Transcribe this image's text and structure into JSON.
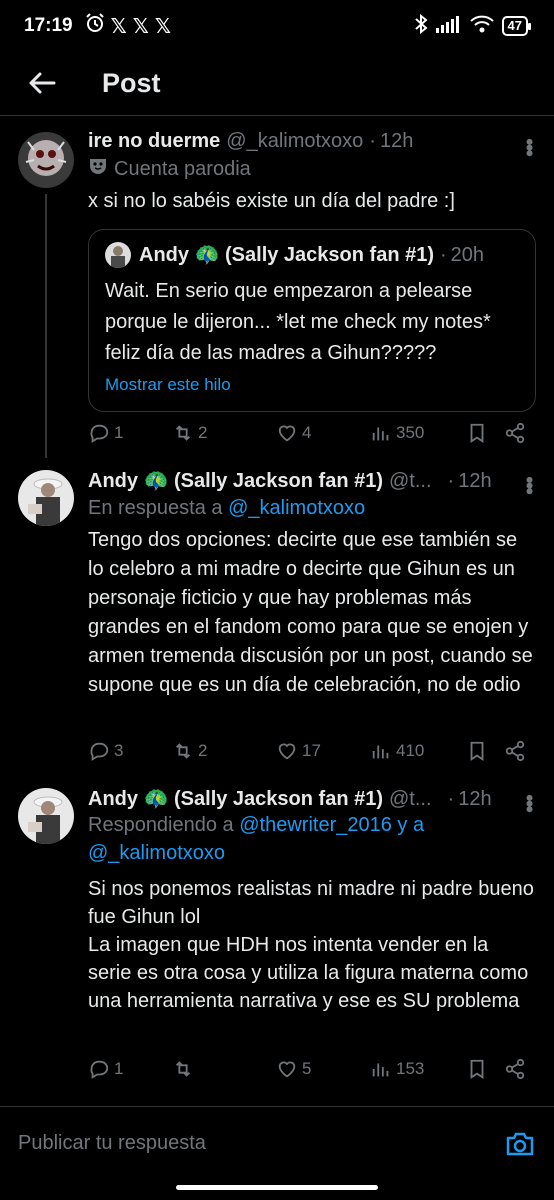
{
  "status_bar": {
    "time": "17:19",
    "battery": "47"
  },
  "header": {
    "title": "Post"
  },
  "posts": [
    {
      "display_name": "ire no duerme",
      "handle": "@_kalimotxoxo",
      "time": "12h",
      "label": "Cuenta parodia",
      "text": "x si no lo sabéis existe un día del padre :]",
      "quote": {
        "display_name": "Andy 🦚 (Sally Jackson fan #1)",
        "time": "20h",
        "text": "Wait. En serio que empezaron a pelearse porque le dijeron... *let me check my notes* feliz día de las madres a Gihun?????",
        "show_thread": "Mostrar este hilo"
      },
      "replies": "1",
      "retweets": "2",
      "likes": "4",
      "views": "350"
    },
    {
      "display_name": "Andy 🦚 (Sally Jackson fan #1)",
      "handle": "@t...",
      "time": "12h",
      "reply_prefix": "En respuesta a ",
      "reply_to": "@_kalimotxoxo",
      "text": "Tengo dos opciones: decirte que ese también se lo celebro a mi madre o decirte que Gihun es un personaje ficticio y que hay problemas más grandes en el fandom como para que se enojen y armen tremenda discusión por un post, cuando se supone que es un día de celebración, no de odio",
      "replies": "3",
      "retweets": "2",
      "likes": "17",
      "views": "410"
    },
    {
      "display_name": "Andy 🦚 (Sally Jackson fan #1)",
      "handle": "@t...",
      "time": "12h",
      "reply_prefix": "Respondiendo a ",
      "reply_to": "@thewriter_2016 y a @_kalimotxoxo",
      "text": "Si nos ponemos realistas ni madre ni padre bueno fue Gihun lol\nLa imagen que HDH nos intenta vender en la serie es otra cosa y utiliza la figura materna como una herramienta narrativa y ese es SU problema",
      "replies": "1",
      "retweets": "",
      "likes": "5",
      "views": "153"
    }
  ],
  "reply_bar": {
    "placeholder": "Publicar tu respuesta"
  },
  "colors": {
    "background": "#000000",
    "text": "#e7e9ea",
    "muted": "#71767b",
    "accent": "#1d9bf0",
    "border": "#2f3336"
  }
}
